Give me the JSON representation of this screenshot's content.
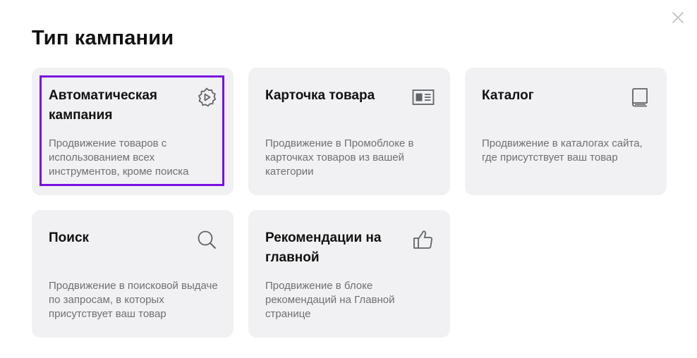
{
  "dialog": {
    "title": "Тип кампании",
    "close_icon": "close-icon"
  },
  "cards": [
    {
      "title": "Автоматическая кампания",
      "description": "Продвижение товаров с использованием всех инструментов, кроме поиска",
      "icon": "gear-play-icon",
      "selected": true
    },
    {
      "title": "Карточка товара",
      "description": "Продвижение в Промоблоке в карточках товаров из вашей категории",
      "icon": "product-card-icon",
      "selected": false
    },
    {
      "title": "Каталог",
      "description": "Продвижение в каталогах сайта, где присутствует ваш товар",
      "icon": "book-icon",
      "selected": false
    },
    {
      "title": "Поиск",
      "description": "Продвижение в поисковой выдаче по запросам, в которых присутствует ваш товар",
      "icon": "search-icon",
      "selected": false
    },
    {
      "title": "Рекомендации на главной",
      "description": "Продвижение в блоке рекомендаций на Главной странице",
      "icon": "thumbs-up-icon",
      "selected": false
    }
  ],
  "colors": {
    "accent": "#7a10e0",
    "card_bg": "#f1f1f3",
    "icon": "#5f6368",
    "text_secondary": "#6f6f74"
  }
}
